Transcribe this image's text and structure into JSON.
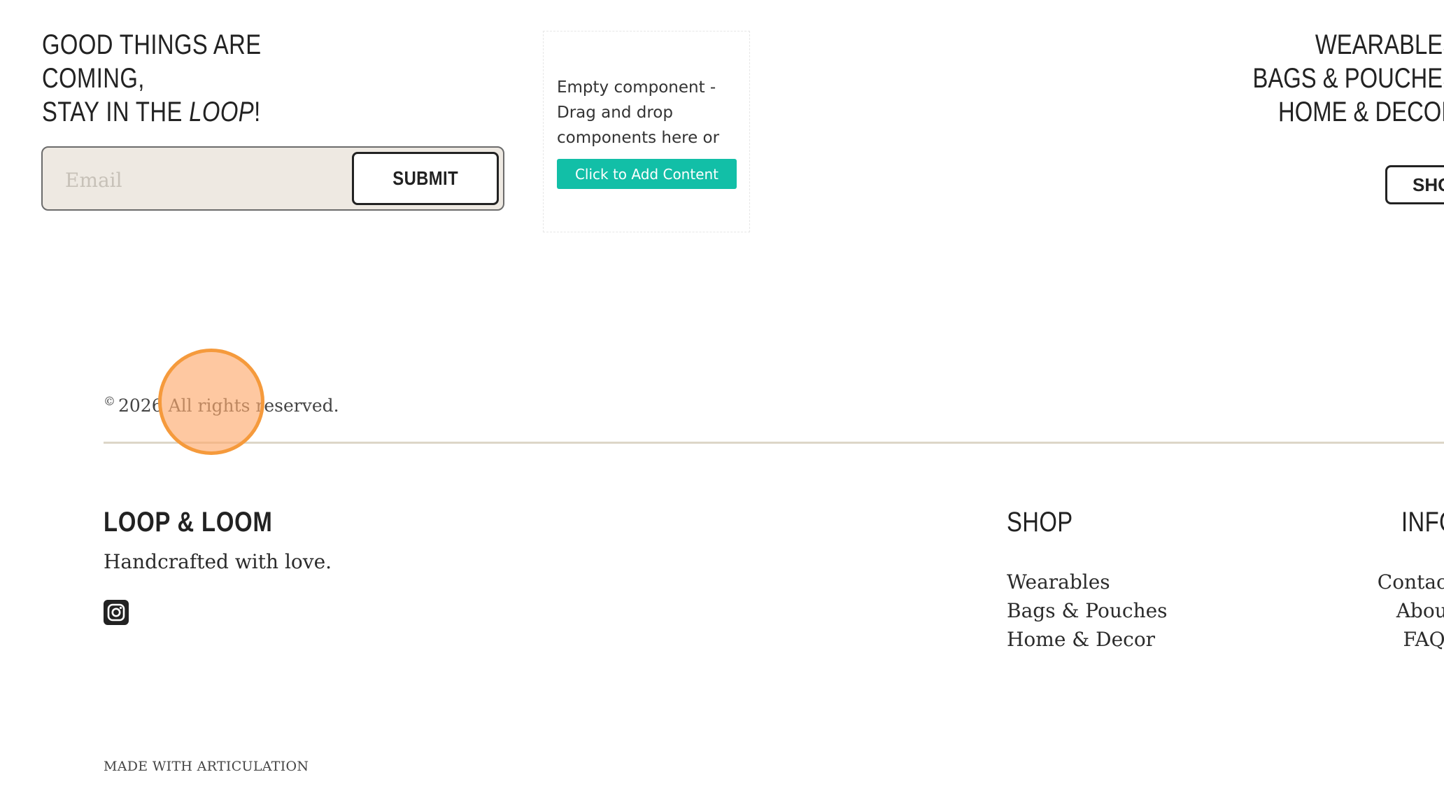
{
  "newsletter": {
    "title_line1": "GOOD THINGS ARE COMING,",
    "title_line2_pre": "STAY IN THE ",
    "title_line2_em": "LOOP",
    "title_line2_post": "!",
    "email_placeholder": "Email",
    "submit_label": "SUBMIT"
  },
  "empty_component": {
    "message": "Empty component - Drag and drop components here or",
    "button_label": "Click to Add Content",
    "button_color": "#12bfa7"
  },
  "categories": {
    "items": [
      "WEARABLES",
      "BAGS & POUCHES",
      "HOME & DECOR"
    ],
    "shop_button_label": "SHOP"
  },
  "footer": {
    "copyright_symbol": "©",
    "copyright_text": "2026 All rights reserved.",
    "brand": "LOOP & LOOM",
    "tagline": "Handcrafted with love.",
    "social_icon": "instagram-icon",
    "shop_heading": "SHOP",
    "shop_links": [
      "Wearables",
      "Bags & Pouches",
      "Home & Decor"
    ],
    "info_heading": "INFO",
    "info_links": [
      "Contact",
      "About",
      "FAQs"
    ],
    "made_with": "MADE WITH ARTICULATION"
  },
  "colors": {
    "input_bg": "#eee9e2",
    "divider": "#ddd6c8",
    "click_indicator": "#f59a3c"
  }
}
